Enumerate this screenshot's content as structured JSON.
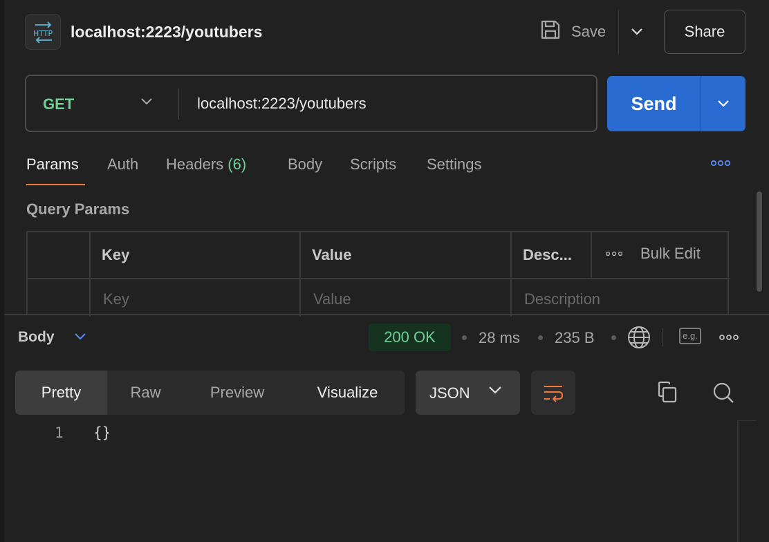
{
  "request": {
    "title": "localhost:2223/youtubers",
    "badge_icon": "http-icon",
    "save_label": "Save",
    "share_label": "Share",
    "method": "GET",
    "method_color": "#6fcf97",
    "url": "localhost:2223/youtubers",
    "send_label": "Send",
    "accent": "#2a6bd1"
  },
  "tabs": {
    "items": [
      {
        "label": "Params"
      },
      {
        "label": "Auth"
      },
      {
        "label": "Headers",
        "count": "(6)"
      },
      {
        "label": "Body"
      },
      {
        "label": "Scripts"
      },
      {
        "label": "Settings"
      }
    ],
    "active": "Params",
    "active_color": "#ee7a3c"
  },
  "query_params": {
    "title": "Query Params",
    "headers": [
      "Key",
      "Value",
      "Desc..."
    ],
    "bulk_edit": "Bulk Edit",
    "placeholders": {
      "key": "Key",
      "value": "Value",
      "description": "Description"
    }
  },
  "response": {
    "section_label": "Body",
    "status": "200 OK",
    "status_color": "#6fcf97",
    "time": "28 ms",
    "size": "235 B",
    "views": [
      "Pretty",
      "Raw",
      "Preview",
      "Visualize"
    ],
    "active_view": "Pretty",
    "format": "JSON",
    "code_lines": [
      {
        "number": "1",
        "text": "{}"
      }
    ]
  }
}
